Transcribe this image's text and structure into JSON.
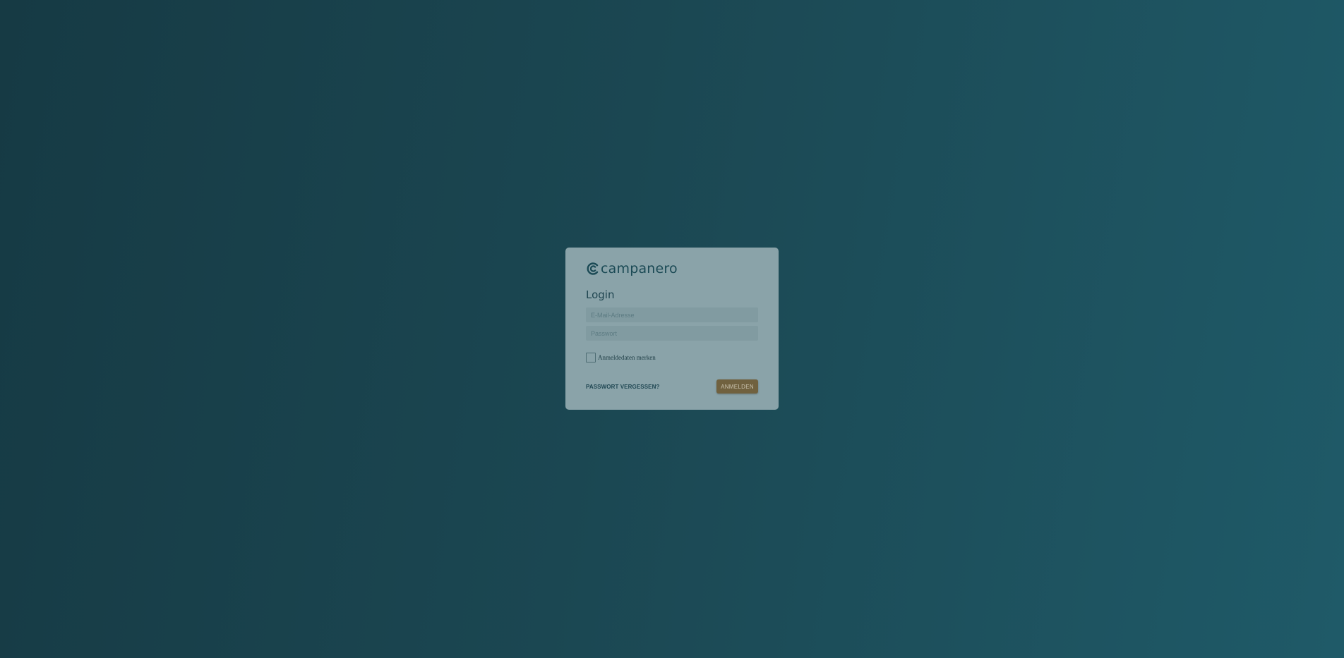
{
  "brand": {
    "name": "campanero",
    "color": "#1b4a55"
  },
  "login": {
    "title": "Login",
    "email_placeholder": "E-Mail-Adresse",
    "password_placeholder": "Passwort",
    "remember_label": "Anmeldedaten merken",
    "remember_checked": false,
    "forgot_link": "PASSWORT VERGESSEN?",
    "submit_label": "ANMELDEN"
  },
  "colors": {
    "background_start": "#163a44",
    "background_end": "#1f5a68",
    "card": "#8aa3a9",
    "accent_button": "#70613f"
  }
}
